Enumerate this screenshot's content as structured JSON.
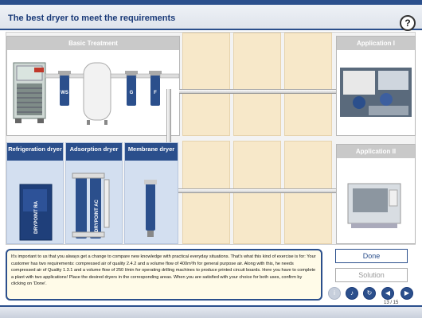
{
  "header": {
    "title": "The best dryer to meet the requirements",
    "help_glyph": "?"
  },
  "stage": {
    "basic_treatment_label": "Basic Treatment",
    "compressor_badge": "MHB",
    "filter_labels": [
      "WS",
      "G",
      "F"
    ],
    "application_1_label": "Application I",
    "application_2_label": "Application II"
  },
  "dryers": [
    {
      "label": "Refrigeration dryer",
      "unit_text": "DRYPOINT RA"
    },
    {
      "label": "Adsorption dryer",
      "unit_text": "DRYPOINT AC"
    },
    {
      "label": "Membrane dryer"
    }
  ],
  "instructions": "It's important to us that you always get a change to compare new knowledge with practical everyday situations. That's what this kind of exercise is for: Your customer has two requirements: compressed air of quality 2.4.2 and a volume flow of 400m³/h for general purpose air. Along with this, he needs compressed air of Quality 1.3.1 and a volume flow of 250 l/min for operating drilling machines to produce printed circuit boards. Here you have to complete a plant with two applications! Place the desired dryers in the corresponding areas. When you are satisfied with your choice for both uses, confirm by clicking on 'Done'.",
  "buttons": {
    "done": "Done",
    "solution": "Solution"
  },
  "controls": {
    "help_icon": "info-icon",
    "sound_icon": "speaker-icon",
    "replay_icon": "replay-icon",
    "prev_icon": "arrow-left-icon",
    "next_icon": "arrow-right-icon"
  },
  "pager": "13 / 15",
  "colors": {
    "accent": "#2b4f8c",
    "zone": "#f7e8c9",
    "dryer_panel": "#d3dff0"
  }
}
